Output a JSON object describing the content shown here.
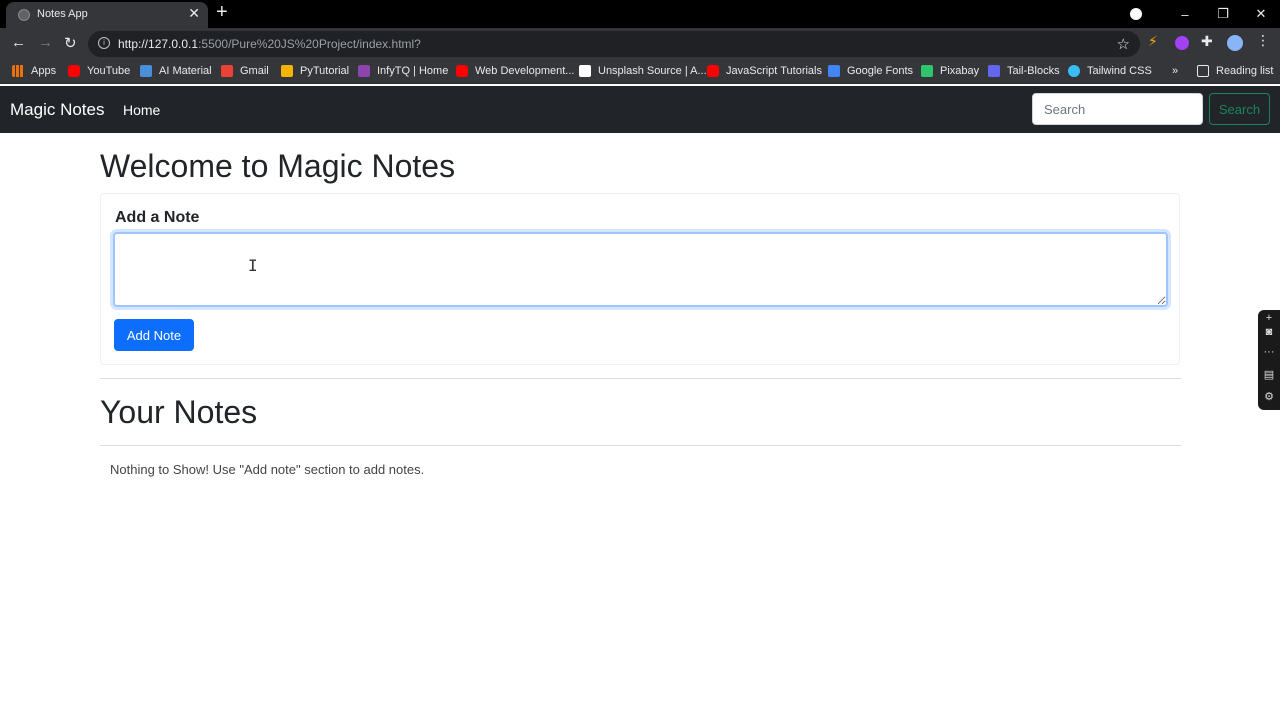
{
  "browser": {
    "tab_title": "Notes App",
    "tab_close": "✕",
    "new_tab": "+",
    "url_host": "http://127.0.0.1",
    "url_rest": ":5500/Pure%20JS%20Project/index.html?",
    "window_controls": [
      "–",
      "❐",
      "✕"
    ],
    "bookmarks": [
      {
        "label": "Apps",
        "color": "#e8710a"
      },
      {
        "label": "YouTube",
        "color": "#ff0000"
      },
      {
        "label": "AI Material",
        "color": "#4a90d9"
      },
      {
        "label": "Gmail",
        "color": "#ea4335"
      },
      {
        "label": "PyTutorial",
        "color": "#f4b400"
      },
      {
        "label": "InfyTQ | Home",
        "color": "#8e44ad"
      },
      {
        "label": "Web Development...",
        "color": "#ff0000"
      },
      {
        "label": "Unsplash Source | A...",
        "color": "#ffffff"
      },
      {
        "label": "JavaScript Tutorials",
        "color": "#ff0000"
      },
      {
        "label": "Google Fonts",
        "color": "#4285f4"
      },
      {
        "label": "Pixabay",
        "color": "#2ec66d"
      },
      {
        "label": "Tail-Blocks",
        "color": "#6366f1"
      },
      {
        "label": "Tailwind CSS",
        "color": "#38bdf8"
      }
    ],
    "bookmarks_overflow": "»",
    "reading_list": "Reading list"
  },
  "navbar": {
    "brand": "Magic Notes",
    "home": "Home",
    "search_placeholder": "Search",
    "search_button": "Search"
  },
  "main": {
    "welcome_title": "Welcome to Magic Notes",
    "add_note_title": "Add a Note",
    "add_note_button": "Add Note",
    "your_notes_title": "Your Notes",
    "empty_message": "Nothing to Show! Use \"Add note\" section to add notes."
  },
  "colors": {
    "primary": "#0d6efd",
    "success": "#198754",
    "navbar_bg": "#212529"
  }
}
